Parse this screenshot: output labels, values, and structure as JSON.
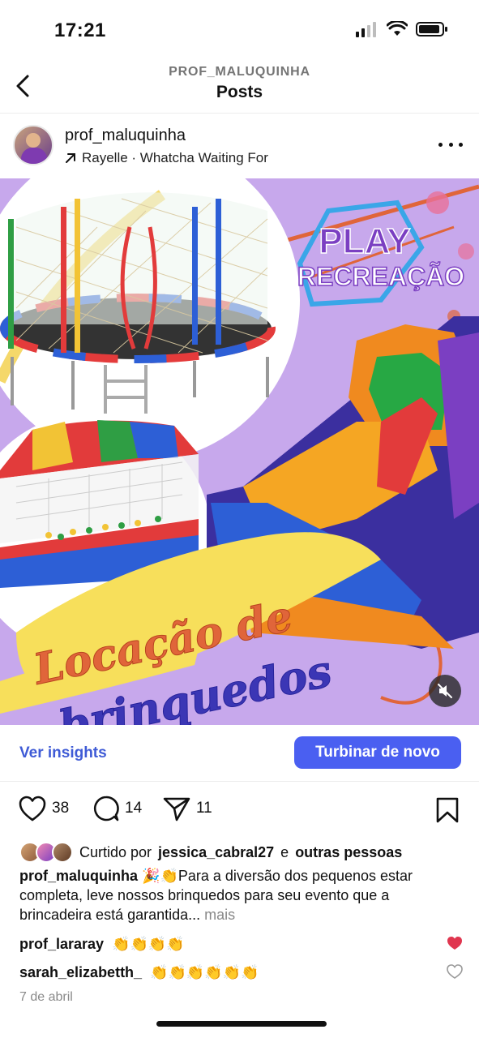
{
  "status_bar": {
    "time": "17:21"
  },
  "header": {
    "account": "PROF_MALUQUINHA",
    "title": "Posts"
  },
  "post": {
    "username": "prof_maluquinha",
    "audio": "Rayelle · Whatcha Waiting For"
  },
  "media": {
    "logo_line1": "PLAY",
    "logo_line2": "RECREAÇÃO",
    "headline_line1": "Locação de",
    "headline_line2": "brinquedos"
  },
  "insights": {
    "link": "Ver insights",
    "boost": "Turbinar de novo"
  },
  "actions": {
    "likes": "38",
    "comments": "14",
    "shares": "11"
  },
  "liked_by": {
    "prefix": "Curtido por",
    "user": "jessica_cabral27",
    "joiner": "e",
    "rest": "outras pessoas"
  },
  "caption": {
    "user": "prof_maluquinha",
    "text": "🎉👏Para a diversão dos pequenos estar completa, leve nossos brinquedos para seu evento que a brincadeira está garantida...",
    "more": "mais"
  },
  "comments": [
    {
      "user": "prof_lararay",
      "text": "👏👏👏👏",
      "liked": true
    },
    {
      "user": "sarah_elizabetth_",
      "text": "👏👏👏👏👏👏",
      "liked": false
    }
  ],
  "date": "7 de abril",
  "colors": {
    "accent": "#4a5ff1",
    "link": "#3f5bd6",
    "media_bg": "#c7a8ec",
    "heart_red": "#e0364f"
  }
}
